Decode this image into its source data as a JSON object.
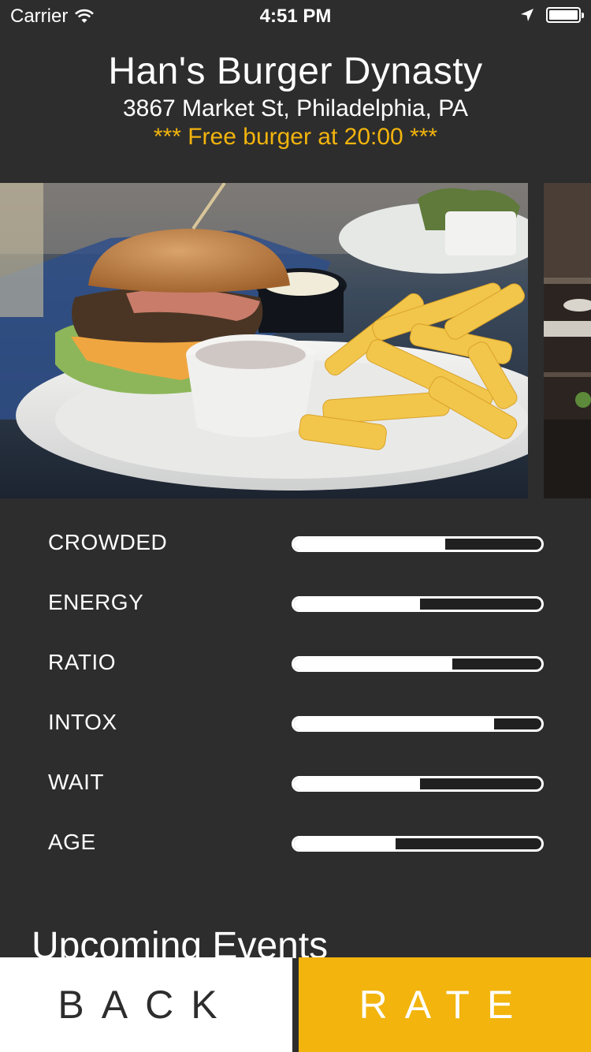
{
  "status_bar": {
    "carrier": "Carrier",
    "time": "4:51 PM",
    "wifi_icon": "wifi-icon",
    "location_icon": "location-arrow-icon",
    "battery_icon": "battery-icon"
  },
  "venue": {
    "name": "Han's Burger Dynasty",
    "address": "3867 Market St, Philadelphia, PA",
    "promo": "*** Free burger at 20:00 ***"
  },
  "colors": {
    "background": "#2d2d2d",
    "accent": "#f2b40d",
    "text": "#ffffff"
  },
  "stats": [
    {
      "label": "CROWDED",
      "level": 0.61
    },
    {
      "label": "ENERGY",
      "level": 0.51
    },
    {
      "label": "RATIO",
      "level": 0.64
    },
    {
      "label": "INTOX",
      "level": 0.81
    },
    {
      "label": "WAIT",
      "level": 0.51
    },
    {
      "label": "AGE",
      "level": 0.41
    }
  ],
  "upcoming": {
    "title": "Upcoming Events"
  },
  "buttons": {
    "back": "BACK",
    "rate": "RATE"
  }
}
